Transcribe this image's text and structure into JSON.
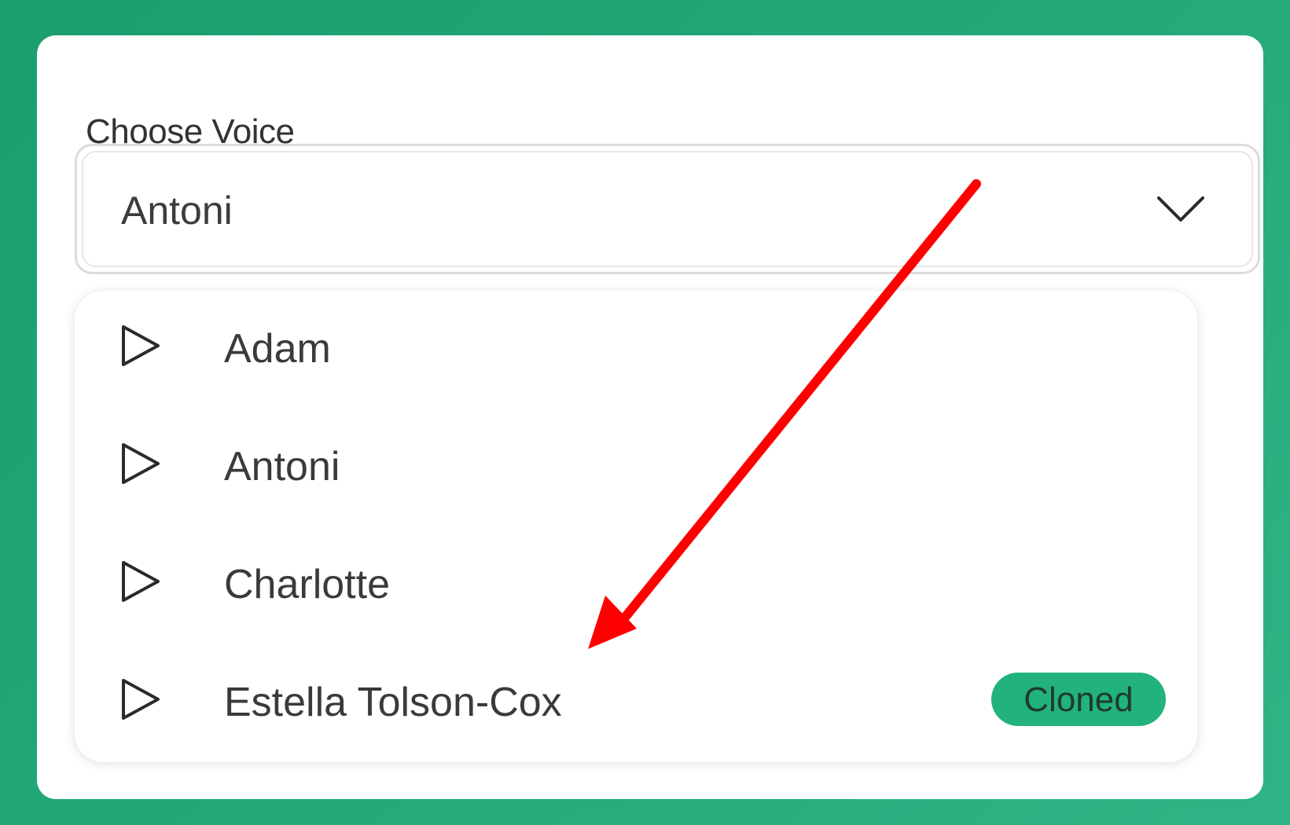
{
  "field": {
    "label": "Choose Voice",
    "selected_value": "Antoni"
  },
  "options": [
    {
      "name": "Adam",
      "badge": ""
    },
    {
      "name": "Antoni",
      "badge": ""
    },
    {
      "name": "Charlotte",
      "badge": ""
    },
    {
      "name": "Estella Tolson-Cox",
      "badge": "Cloned"
    }
  ],
  "colors": {
    "background": "#1fa372",
    "badge": "#22b27c",
    "annotation_arrow": "#ff0000"
  },
  "icons": {
    "dropdown": "chevron-down-icon",
    "option": "play-icon"
  }
}
